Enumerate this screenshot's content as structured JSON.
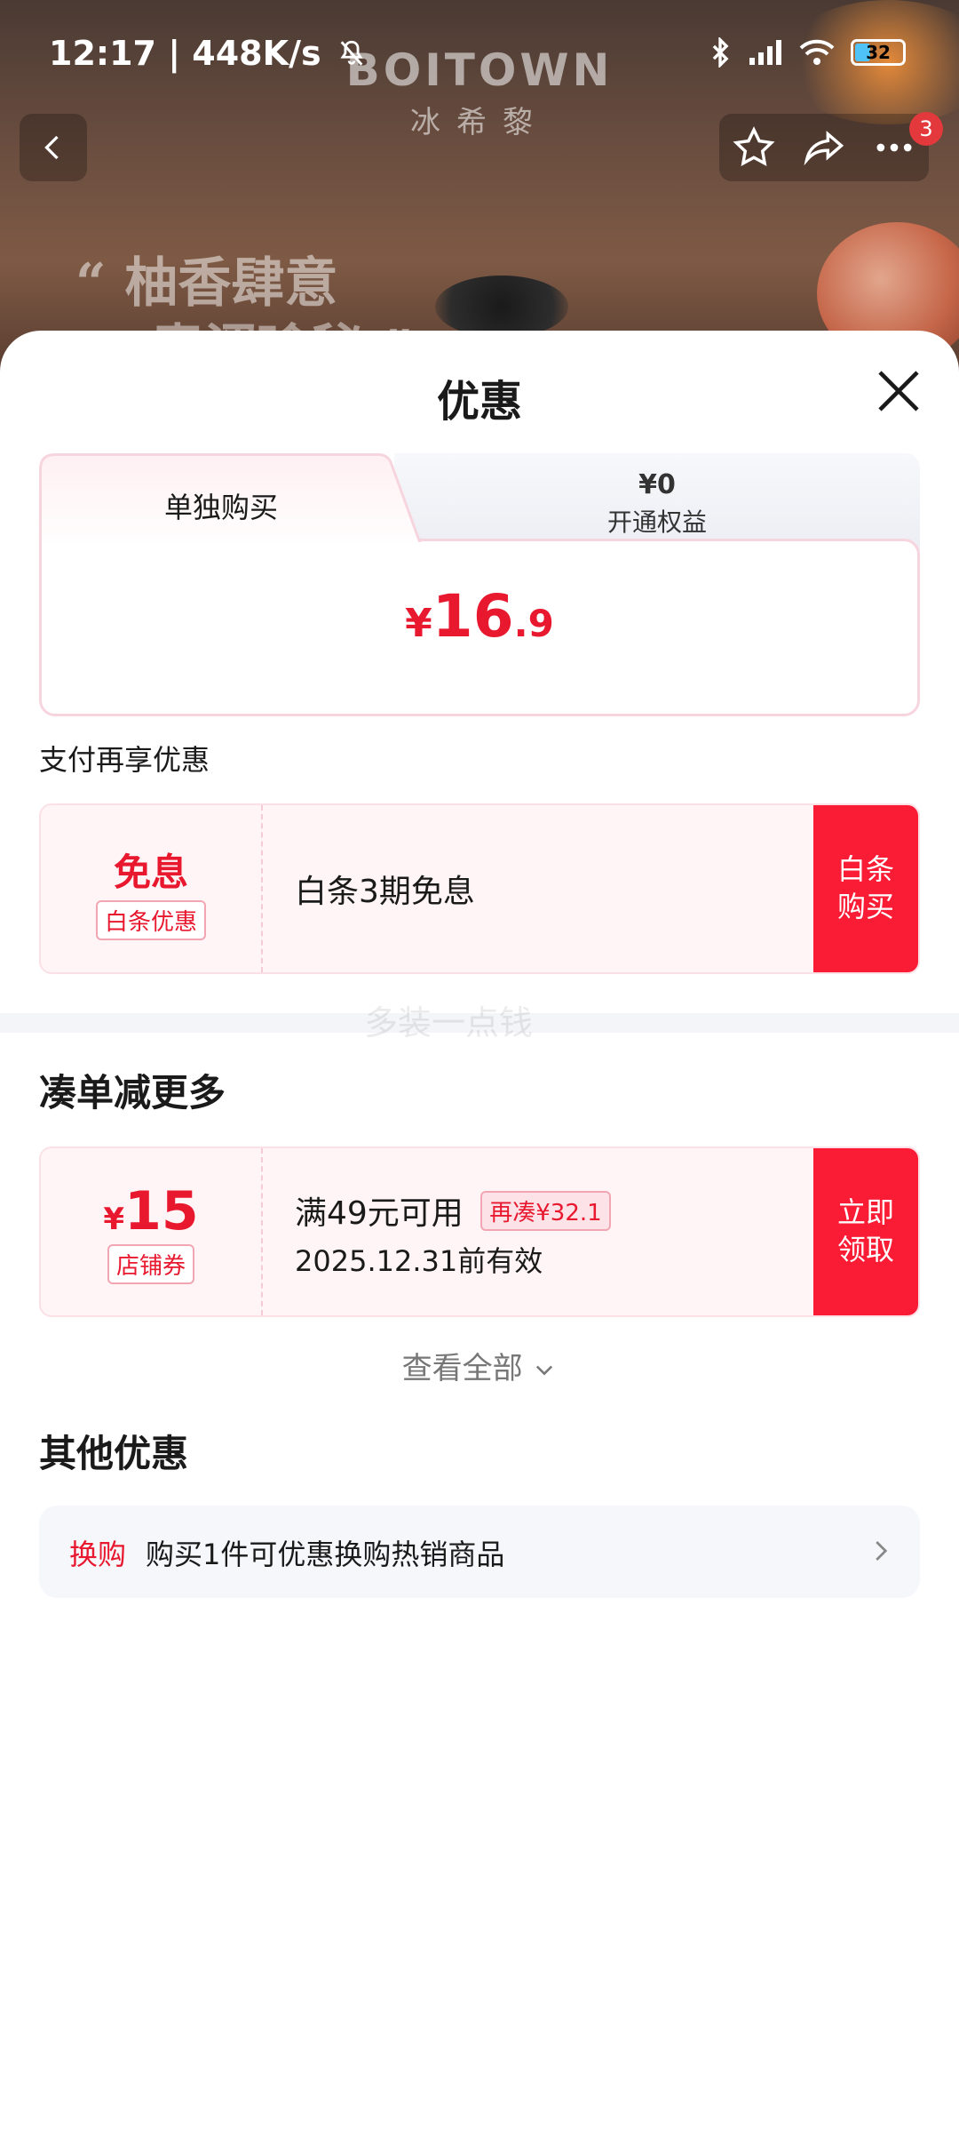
{
  "status_bar": {
    "time": "12:17 | 448K/s",
    "battery": "32"
  },
  "background": {
    "brand_en": "BOITOWN",
    "brand_cn": "冰希黎",
    "slogan_line1": "“ 柚香肆意",
    "slogan_line2": "青涩瑜秘 ”"
  },
  "nav": {
    "badge_count": "3"
  },
  "sheet": {
    "title": "优惠",
    "tabs": {
      "solo_label": "单独购买",
      "member_price": "¥0",
      "member_label": "开通权益"
    },
    "price": {
      "currency": "¥",
      "integer": "16",
      "decimal": ".9"
    },
    "pay_more_title": "支付再享优惠",
    "baitiao": {
      "headline": "免息",
      "tag": "白条优惠",
      "desc": "白条3期免息",
      "action": "白条\n购买"
    },
    "watermark": "多装一点钱",
    "bundle_title": "凑单减更多",
    "coupon": {
      "currency": "¥",
      "amount": "15",
      "tag": "店铺券",
      "condition": "满49元可用",
      "extra_tag": "再凑¥32.1",
      "validity": "2025.12.31前有效",
      "action": "立即\n领取"
    },
    "view_all": "查看全部",
    "other_title": "其他优惠",
    "other": {
      "tag": "换购",
      "text": "购买1件可优惠换购热销商品"
    }
  },
  "colors": {
    "accent": "#e8182f",
    "action_bg": "#fa1b35",
    "coupon_bg": "#fff5f6"
  }
}
